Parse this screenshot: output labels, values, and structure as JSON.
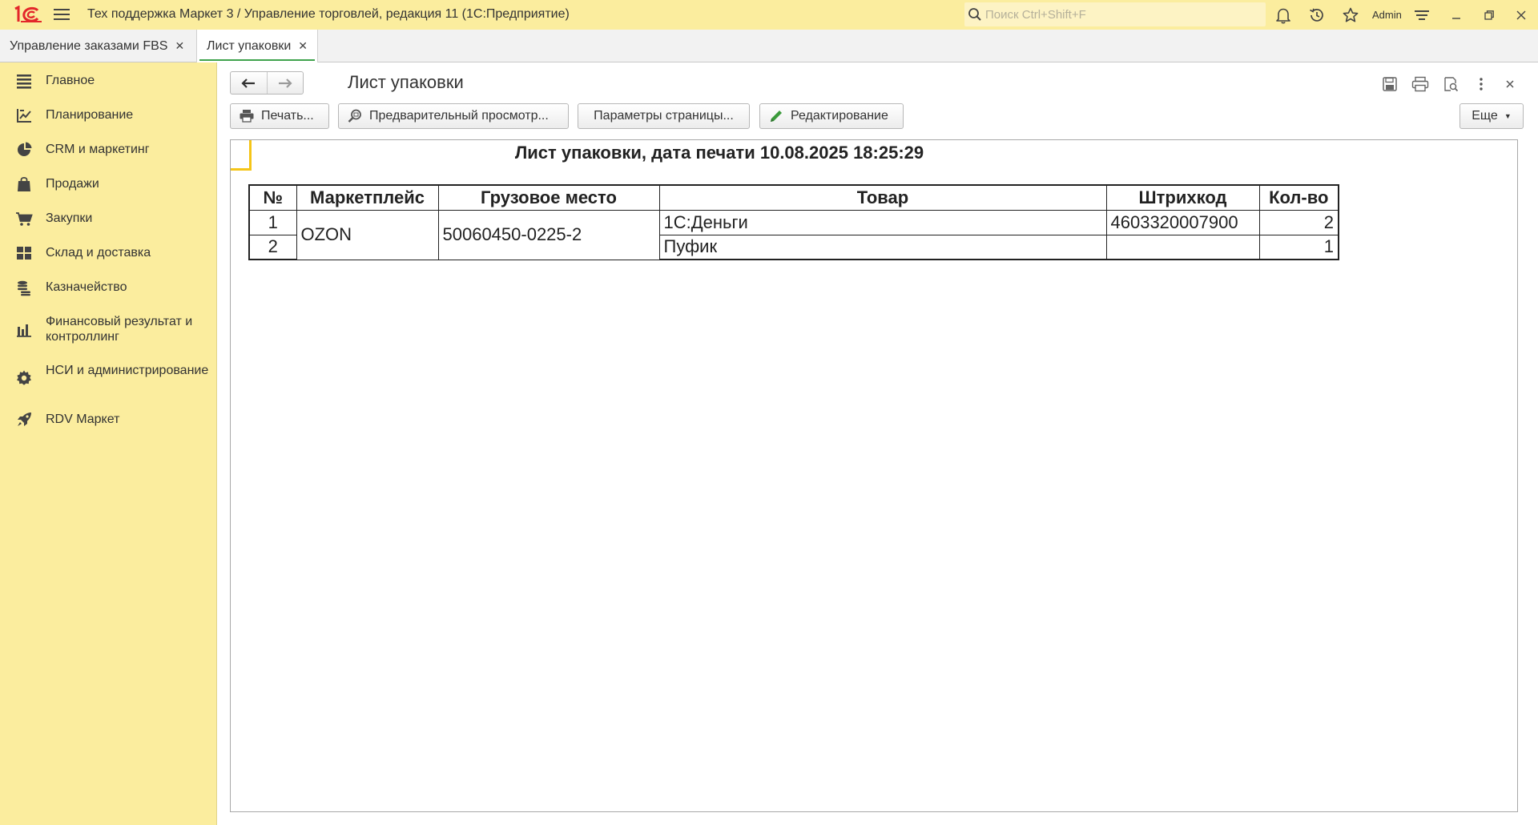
{
  "app": {
    "title": "Тех поддержка Маркет 3 / Управление торговлей, редакция 11  (1С:Предприятие)",
    "search_placeholder": "Поиск Ctrl+Shift+F",
    "user": "Admin",
    "brand_color": "#e3262a"
  },
  "tabs": [
    {
      "label": "Управление заказами FBS",
      "close": "✕",
      "active": false
    },
    {
      "label": "Лист упаковки",
      "close": "✕",
      "active": true
    }
  ],
  "sidebar": {
    "items": [
      {
        "label": "Главное",
        "icon": "menu-lines-icon"
      },
      {
        "label": "Планирование",
        "icon": "planning-chart-icon"
      },
      {
        "label": "CRM и маркетинг",
        "icon": "pie-chart-icon"
      },
      {
        "label": "Продажи",
        "icon": "shopping-bag-icon"
      },
      {
        "label": "Закупки",
        "icon": "cart-icon"
      },
      {
        "label": "Склад и доставка",
        "icon": "warehouse-icon"
      },
      {
        "label": "Казначейство",
        "icon": "coins-icon"
      },
      {
        "label": "Финансовый результат и контроллинг",
        "icon": "bar-chart-icon"
      },
      {
        "label": "НСИ и администрирование",
        "icon": "gear-icon"
      },
      {
        "label": "RDV Маркет",
        "icon": "rocket-icon"
      }
    ]
  },
  "form": {
    "title": "Лист упаковки",
    "buttons": {
      "print": "Печать...",
      "preview": "Предварительный просмотр...",
      "page_params": "Параметры страницы...",
      "edit": "Редактирование",
      "more": "Еще"
    }
  },
  "report": {
    "title": "Лист упаковки, дата печати 10.08.2025 18:25:29",
    "columns": [
      "№",
      "Маркетплейс",
      "Грузовое место",
      "Товар",
      "Штрихкод",
      "Кол-во"
    ],
    "group": {
      "marketplace": "OZON",
      "cargo_place": "50060450-0225-2"
    },
    "rows": [
      {
        "num": "1",
        "product": "1С:Деньги",
        "barcode": "4603320007900",
        "qty": "2"
      },
      {
        "num": "2",
        "product": "Пуфик",
        "barcode": "",
        "qty": "1"
      }
    ]
  }
}
